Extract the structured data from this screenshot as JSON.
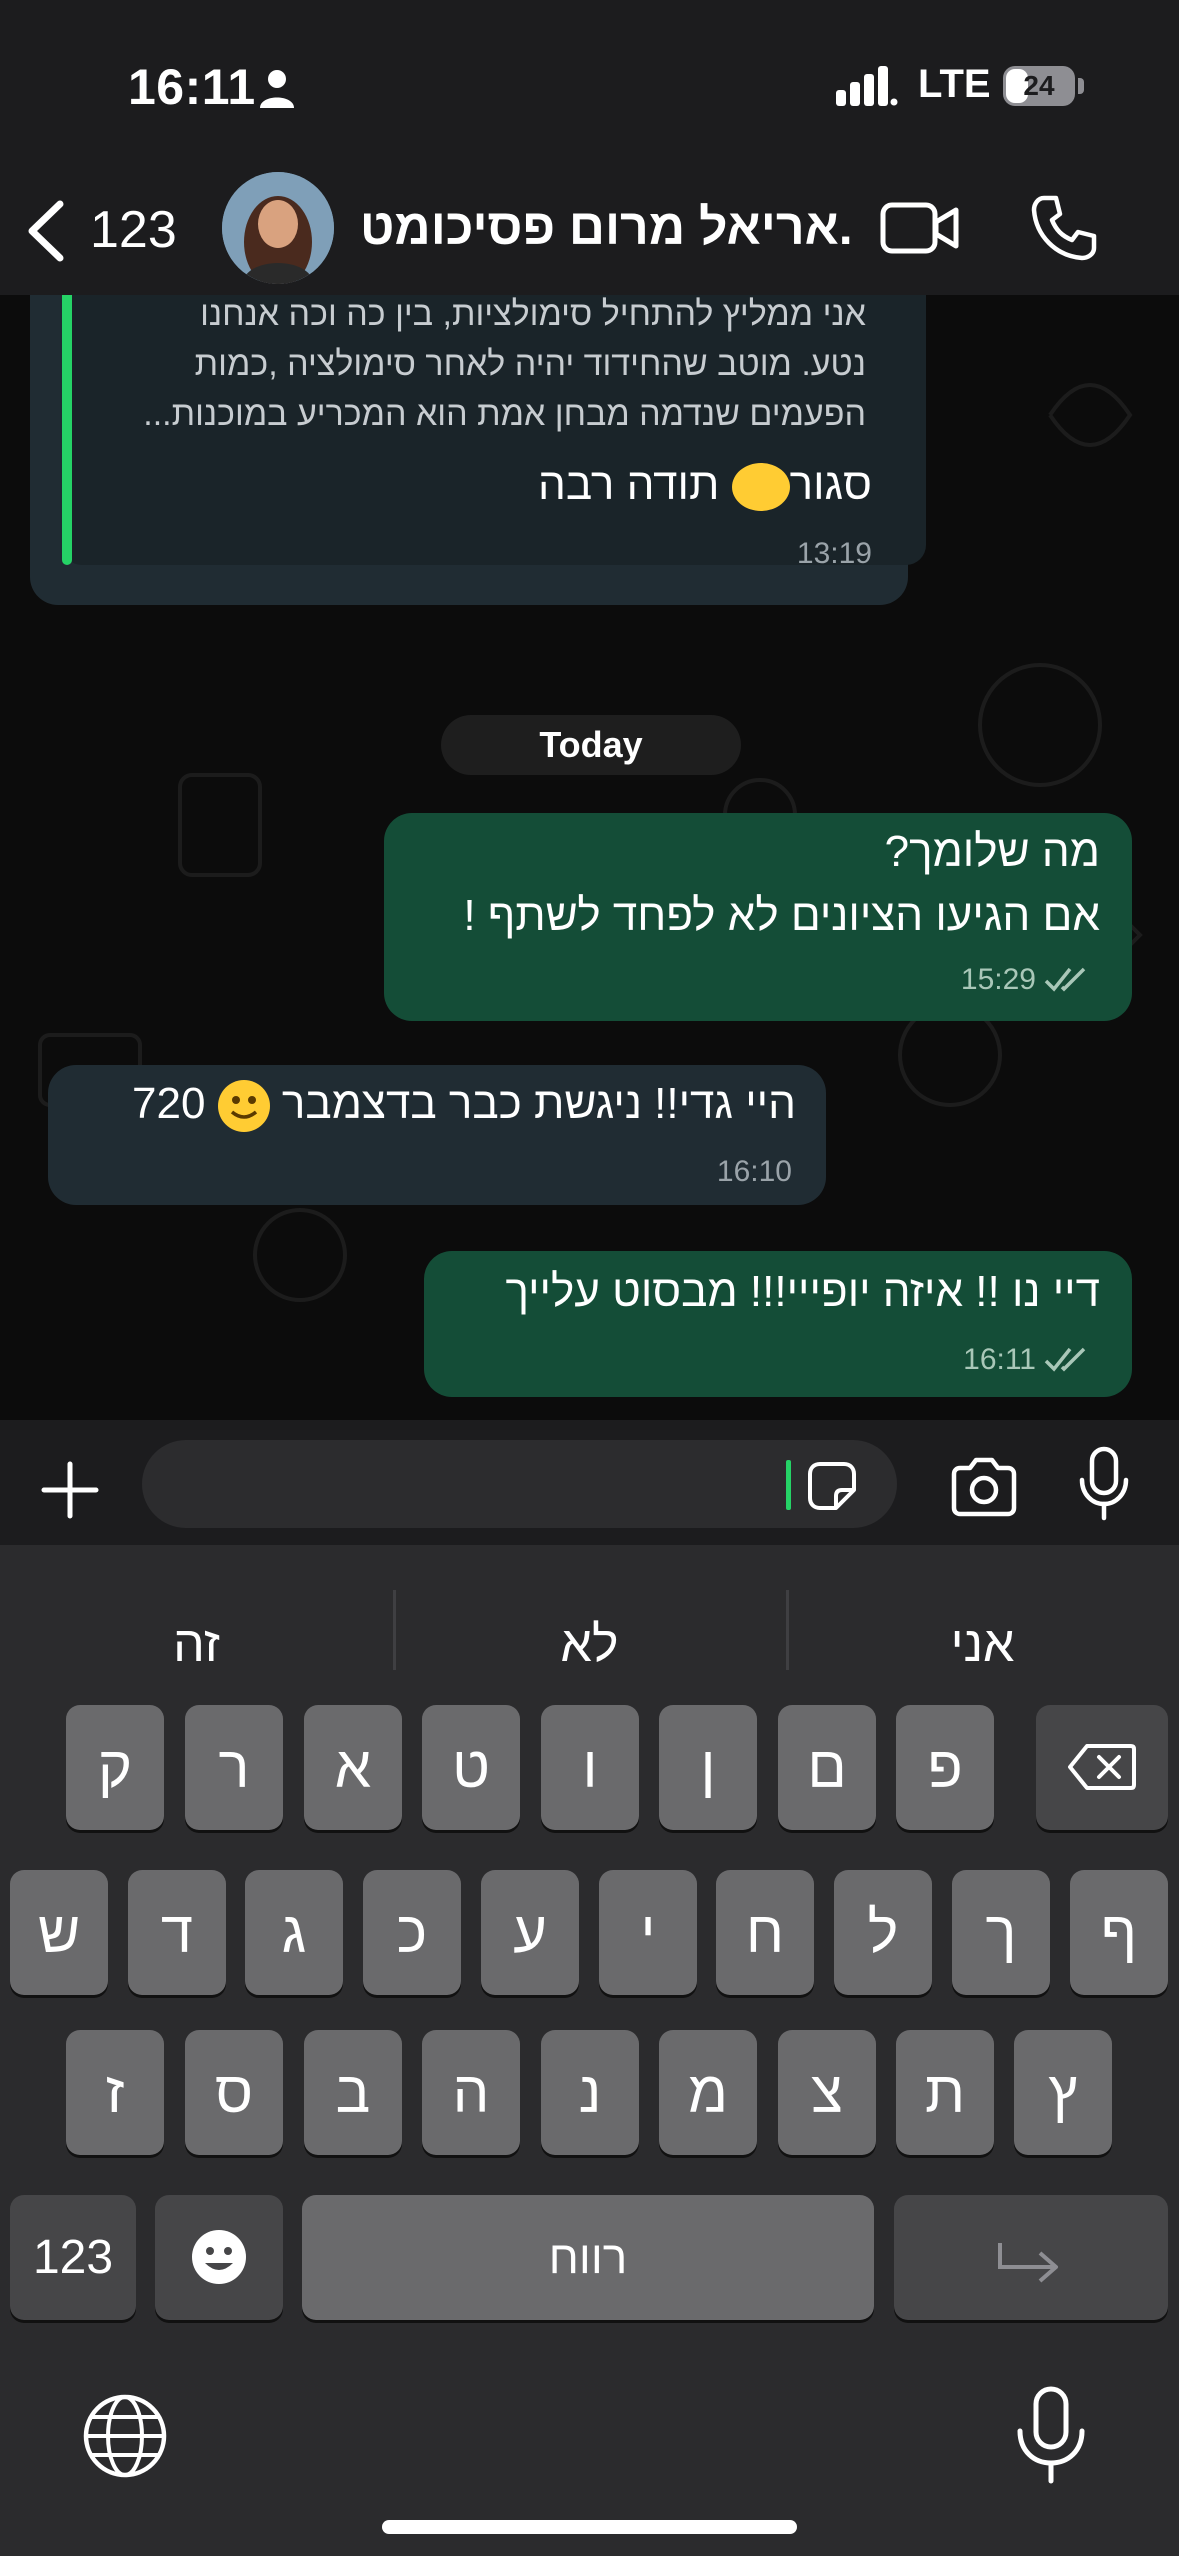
{
  "status_bar": {
    "time": "16:11",
    "network": "LTE",
    "battery": "24"
  },
  "header": {
    "back_count": "123",
    "contact_name": "אריאל מרום פסיכומט...",
    "icons": [
      "back-icon",
      "avatar",
      "video-call-icon",
      "phone-icon"
    ]
  },
  "messages": {
    "quoted": {
      "line1": "אני ממליץ להתחיל סימולציות, בין כה וכה אנחנו",
      "line2": "נטע. מוטב שהחידוד יהיה לאחר סימולציה ,כמות",
      "line3": "הפעמים שנדמה מבחן אמת הוא המכריע במוכנות..."
    },
    "m1": {
      "text_a": "סגור",
      "text_b": " תודה רבה",
      "time": "13:19"
    },
    "day_separator": "Today",
    "m2": {
      "line1": "מה שלומך?",
      "line2": "אם הגיעו הציונים לא לפחד לשתף !",
      "time": "15:29"
    },
    "m3": {
      "text_a": "היי גדי!! ניגשת כבר בדצמבר",
      "text_b": "720",
      "time": "16:10"
    },
    "m4": {
      "text": "דיי נו !! איזה יופייי!!! מבסוט עלייך",
      "time": "16:11"
    }
  },
  "composer": {
    "placeholder": ""
  },
  "keyboard": {
    "suggestions": [
      "זה",
      "לא",
      "אני"
    ],
    "row1": [
      "ק",
      "ר",
      "א",
      "ט",
      "ו",
      "ן",
      "ם",
      "פ"
    ],
    "row2": [
      "ש",
      "ד",
      "ג",
      "כ",
      "ע",
      "י",
      "ח",
      "ל",
      "ך",
      "ף"
    ],
    "row3": [
      "ז",
      "ס",
      "ב",
      "ה",
      "נ",
      "מ",
      "צ",
      "ת",
      "ץ"
    ],
    "numbers_key": "123",
    "space_key": "רווח"
  },
  "colors": {
    "outgoing": "#144d37",
    "incoming": "#202c33",
    "accent": "#25d366"
  }
}
